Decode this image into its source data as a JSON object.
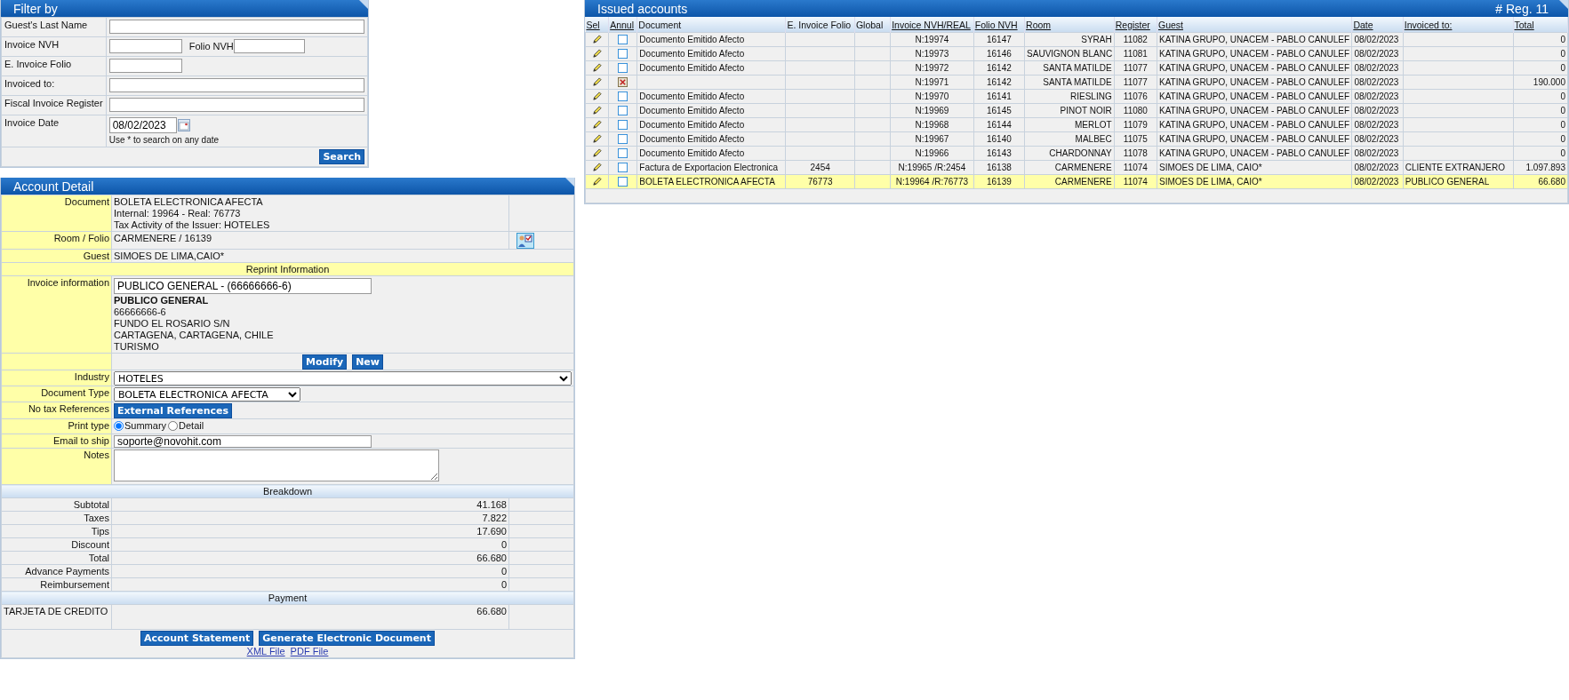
{
  "filter": {
    "title": "Filter by",
    "fields": [
      {
        "kind": "text",
        "label": "Guest's Last Name"
      },
      {
        "kind": "pair",
        "label": "Invoice NVH",
        "second_label": "Folio NVH"
      },
      {
        "kind": "short",
        "label": "E. Invoice Folio"
      },
      {
        "kind": "text",
        "label": "Invoiced to:"
      },
      {
        "kind": "text",
        "label": "Fiscal Invoice Register"
      },
      {
        "kind": "date",
        "label": "Invoice Date",
        "value": "08/02/2023",
        "hint": "Use * to search on any date"
      }
    ],
    "button": "Search"
  },
  "account_detail": {
    "title": "Account Detail",
    "document": {
      "label": "Document",
      "lines": [
        "BOLETA ELECTRONICA AFECTA",
        "Internal: 19964 - Real: 76773",
        "Tax Activity of the Issuer: HOTELES"
      ]
    },
    "room_folio": {
      "label": "Room / Folio",
      "value": "CARMENERE / 16139"
    },
    "guest": {
      "label": "Guest",
      "value": "SIMOES DE LIMA,CAIO*"
    },
    "reprint_heading": "Reprint Information",
    "invoice_info": {
      "label": "Invoice information",
      "field_value": "PUBLICO GENERAL - (66666666-6)",
      "name": "PUBLICO GENERAL",
      "lines": [
        "66666666-6",
        "FUNDO EL ROSARIO S/N",
        "CARTAGENA, CARTAGENA, CHILE",
        "TURISMO"
      ]
    },
    "info_buttons": [
      "Modify",
      "New"
    ],
    "industry": {
      "label": "Industry",
      "value": "HOTELES"
    },
    "document_type": {
      "label": "Document Type",
      "value": "BOLETA ELECTRONICA AFECTA"
    },
    "references": {
      "label": "No tax References",
      "button": "External References"
    },
    "print_type": {
      "label": "Print type",
      "options": [
        {
          "label": "Summary",
          "selected": true
        },
        {
          "label": "Detail",
          "selected": false
        }
      ]
    },
    "email": {
      "label": "Email to ship",
      "value": "soporte@novohit.com"
    },
    "notes": {
      "label": "Notes"
    },
    "breakdown_heading": "Breakdown",
    "breakdown": [
      {
        "label": "Subtotal",
        "value": "41.168"
      },
      {
        "label": "Taxes",
        "value": "7.822"
      },
      {
        "label": "Tips",
        "value": "17.690"
      },
      {
        "label": "Discount",
        "value": "0"
      },
      {
        "label": "Total",
        "value": "66.680"
      },
      {
        "label": "Advance Payments",
        "value": "0"
      },
      {
        "label": "Reimbursement",
        "value": "0"
      }
    ],
    "payment_heading": "Payment",
    "payments": [
      {
        "label": "TARJETA DE CREDITO",
        "value": "66.680"
      }
    ],
    "action_buttons": [
      "Account Statement",
      "Generate Electronic Document"
    ],
    "links": [
      "XML File",
      "PDF File"
    ]
  },
  "issued_accounts": {
    "title": "Issued accounts",
    "count": "# Reg. 11",
    "columns": [
      {
        "label": "Sel",
        "sortable": true
      },
      {
        "label": "Annul",
        "sortable": true
      },
      {
        "label": "Document",
        "sortable": false
      },
      {
        "label": "E. Invoice Folio",
        "sortable": false
      },
      {
        "label": "Global",
        "sortable": false
      },
      {
        "label": "Invoice NVH/REAL",
        "sortable": true
      },
      {
        "label": "Folio NVH",
        "sortable": true
      },
      {
        "label": "Room",
        "sortable": true
      },
      {
        "label": "Register",
        "sortable": true
      },
      {
        "label": "Guest",
        "sortable": true
      },
      {
        "label": "Date",
        "sortable": true
      },
      {
        "label": "Invoiced to:",
        "sortable": true
      },
      {
        "label": "Total",
        "sortable": true
      }
    ],
    "rows": [
      {
        "annulled": false,
        "selected": false,
        "document": "Documento Emitido Afecto",
        "e_folio": "",
        "invoice": "N:19974",
        "folio": "16147",
        "room": "SYRAH",
        "register": "11082",
        "guest": "KATINA GRUPO, UNACEM - PABLO CANULEF",
        "date": "08/02/2023",
        "invoiced_to": "",
        "total": "0"
      },
      {
        "annulled": false,
        "selected": false,
        "document": "Documento Emitido Afecto",
        "e_folio": "",
        "invoice": "N:19973",
        "folio": "16146",
        "room": "SAUVIGNON BLANC",
        "register": "11081",
        "guest": "KATINA GRUPO, UNACEM - PABLO CANULEF",
        "date": "08/02/2023",
        "invoiced_to": "",
        "total": "0"
      },
      {
        "annulled": false,
        "selected": false,
        "document": "Documento Emitido Afecto",
        "e_folio": "",
        "invoice": "N:19972",
        "folio": "16142",
        "room": "SANTA MATILDE",
        "register": "11077",
        "guest": "KATINA GRUPO, UNACEM - PABLO CANULEF",
        "date": "08/02/2023",
        "invoiced_to": "",
        "total": "0"
      },
      {
        "annulled": true,
        "selected": false,
        "document": "",
        "e_folio": "",
        "invoice": "N:19971",
        "folio": "16142",
        "room": "SANTA MATILDE",
        "register": "11077",
        "guest": "KATINA GRUPO, UNACEM - PABLO CANULEF",
        "date": "08/02/2023",
        "invoiced_to": "",
        "total": "190.000"
      },
      {
        "annulled": false,
        "selected": false,
        "document": "Documento Emitido Afecto",
        "e_folio": "",
        "invoice": "N:19970",
        "folio": "16141",
        "room": "RIESLING",
        "register": "11076",
        "guest": "KATINA GRUPO, UNACEM - PABLO CANULEF",
        "date": "08/02/2023",
        "invoiced_to": "",
        "total": "0"
      },
      {
        "annulled": false,
        "selected": false,
        "document": "Documento Emitido Afecto",
        "e_folio": "",
        "invoice": "N:19969",
        "folio": "16145",
        "room": "PINOT NOIR",
        "register": "11080",
        "guest": "KATINA GRUPO, UNACEM - PABLO CANULEF",
        "date": "08/02/2023",
        "invoiced_to": "",
        "total": "0"
      },
      {
        "annulled": false,
        "selected": false,
        "document": "Documento Emitido Afecto",
        "e_folio": "",
        "invoice": "N:19968",
        "folio": "16144",
        "room": "MERLOT",
        "register": "11079",
        "guest": "KATINA GRUPO, UNACEM - PABLO CANULEF",
        "date": "08/02/2023",
        "invoiced_to": "",
        "total": "0"
      },
      {
        "annulled": false,
        "selected": false,
        "document": "Documento Emitido Afecto",
        "e_folio": "",
        "invoice": "N:19967",
        "folio": "16140",
        "room": "MALBEC",
        "register": "11075",
        "guest": "KATINA GRUPO, UNACEM - PABLO CANULEF",
        "date": "08/02/2023",
        "invoiced_to": "",
        "total": "0"
      },
      {
        "annulled": false,
        "selected": false,
        "document": "Documento Emitido Afecto",
        "e_folio": "",
        "invoice": "N:19966",
        "folio": "16143",
        "room": "CHARDONNAY",
        "register": "11078",
        "guest": "KATINA GRUPO, UNACEM - PABLO CANULEF",
        "date": "08/02/2023",
        "invoiced_to": "",
        "total": "0"
      },
      {
        "annulled": false,
        "selected": false,
        "document": "Factura de Exportacion Electronica",
        "e_folio": "2454",
        "invoice": "N:19965 /R:2454",
        "folio": "16138",
        "room": "CARMENERE",
        "register": "11074",
        "guest": "SIMOES DE LIMA, CAIO*",
        "date": "08/02/2023",
        "invoiced_to": "CLIENTE EXTRANJERO",
        "total": "1.097.893"
      },
      {
        "annulled": false,
        "selected": true,
        "document": "BOLETA ELECTRONICA AFECTA",
        "e_folio": "76773",
        "invoice": "N:19964 /R:76773",
        "folio": "16139",
        "room": "CARMENERE",
        "register": "11074",
        "guest": "SIMOES DE LIMA, CAIO*",
        "date": "08/02/2023",
        "invoiced_to": "PUBLICO GENERAL",
        "total": "66.680"
      }
    ]
  }
}
